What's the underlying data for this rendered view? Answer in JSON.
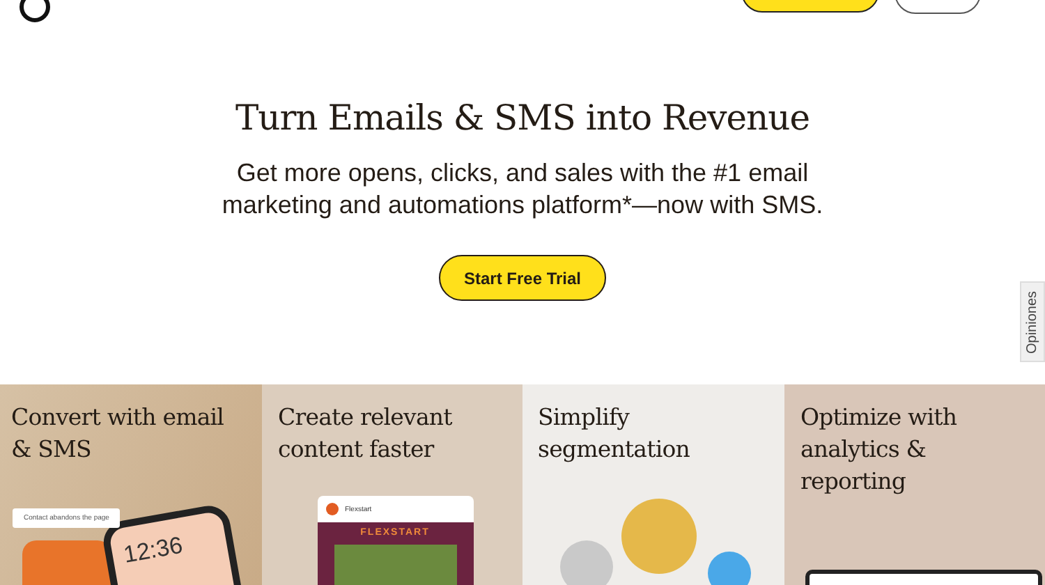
{
  "hero": {
    "title": "Turn Emails & SMS into Revenue",
    "subtitle": "Get more opens, clicks, and sales with the #1 email marketing and automations platform*—now with SMS.",
    "cta": "Start Free Trial"
  },
  "feedback_tab": "Opiniones",
  "features": [
    {
      "kind": "phone",
      "title": "Convert with email & SMS",
      "note": "Contact abandons the page",
      "time": "12:36"
    },
    {
      "kind": "email",
      "title": "Create relevant content faster",
      "brand": "Flexstart",
      "banner": "FLEXSTART"
    },
    {
      "kind": "people",
      "title": "Simplify segmentation"
    },
    {
      "kind": "laptop",
      "title": "Optimize with analytics & reporting"
    }
  ]
}
